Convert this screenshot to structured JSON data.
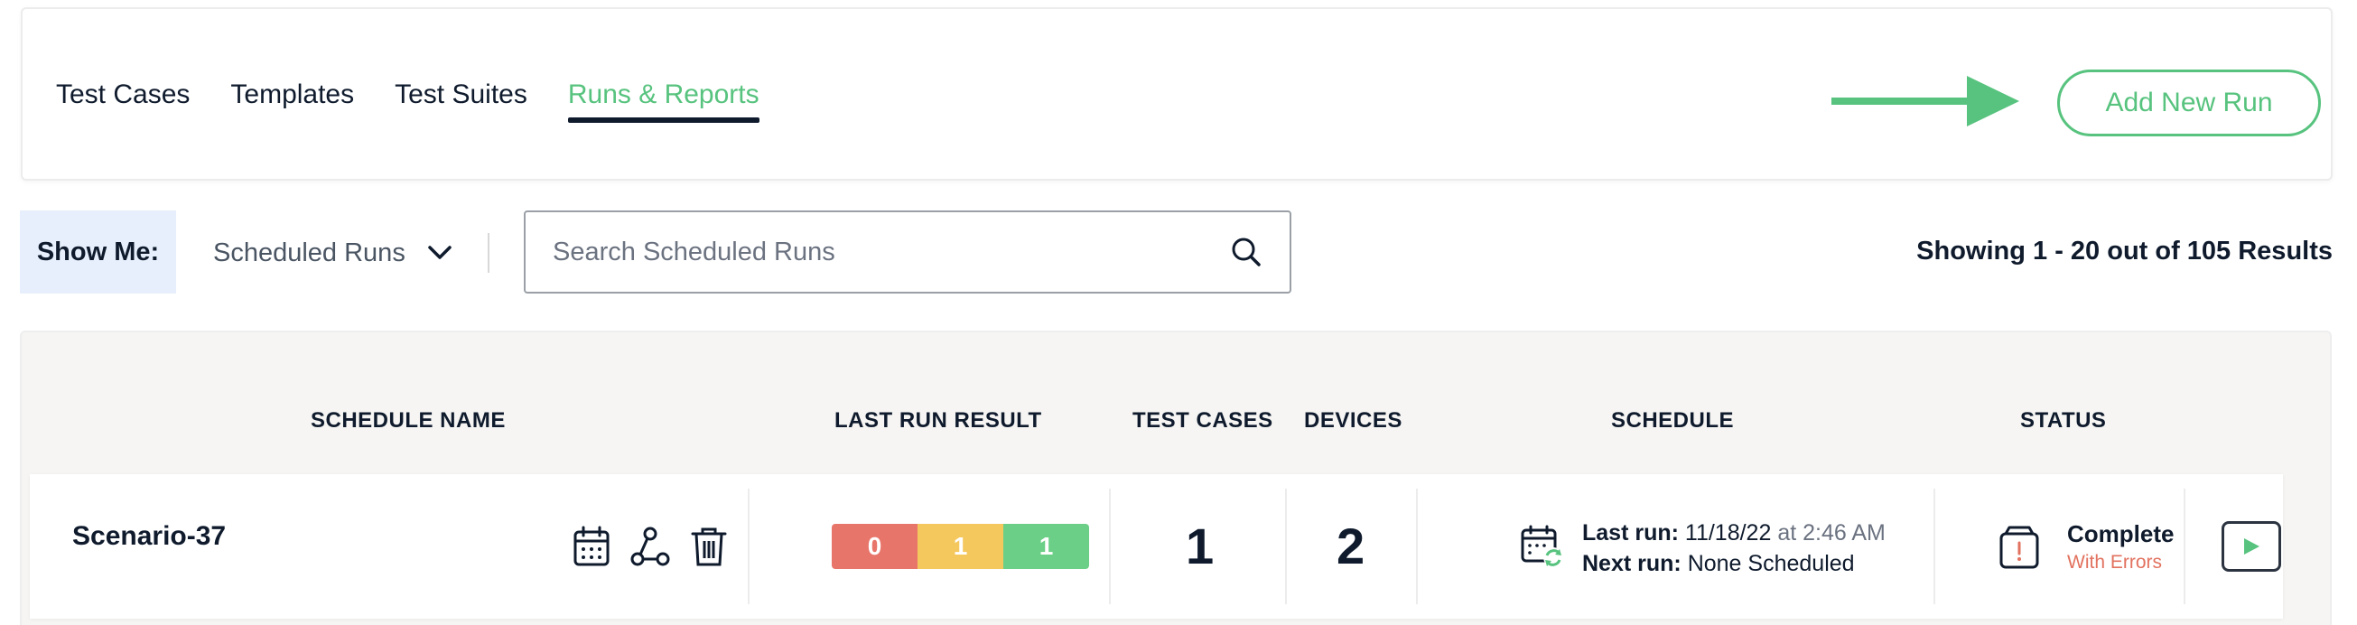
{
  "tabs": [
    {
      "label": "Test Cases",
      "active": false
    },
    {
      "label": "Templates",
      "active": false
    },
    {
      "label": "Test Suites",
      "active": false
    },
    {
      "label": "Runs & Reports",
      "active": true
    }
  ],
  "add_button": {
    "label": "Add New Run"
  },
  "filter": {
    "show_me_label": "Show Me:",
    "selected_option": "Scheduled Runs",
    "search_placeholder": "Search Scheduled Runs",
    "results_text": "Showing 1 - 20 out of 105 Results"
  },
  "table": {
    "columns": [
      "SCHEDULE NAME",
      "LAST RUN RESULT",
      "TEST CASES",
      "DEVICES",
      "SCHEDULE",
      "STATUS"
    ],
    "rows": [
      {
        "name": "Scenario-37",
        "result": {
          "failed": "0",
          "warning": "1",
          "passed": "1"
        },
        "test_cases": "1",
        "devices": "2",
        "last_run_label": "Last run:",
        "last_run_date": "11/18/22",
        "last_run_time": "at 2:46 AM",
        "next_run_label": "Next run:",
        "next_run_value": "None Scheduled",
        "status": "Complete",
        "status_detail": "With Errors"
      }
    ]
  },
  "colors": {
    "accent": "#57c37e",
    "failed": "#e8756a",
    "warning": "#f5c85e",
    "passed": "#6bcf87",
    "error_text": "#e2725f",
    "text": "#0f1b2d"
  },
  "icons": [
    "search-icon",
    "chevron-down-icon",
    "calendar-icon",
    "share-nodes-icon",
    "trash-icon",
    "calendar-refresh-icon",
    "alert-box-icon",
    "play-icon",
    "arrow-right-icon"
  ]
}
